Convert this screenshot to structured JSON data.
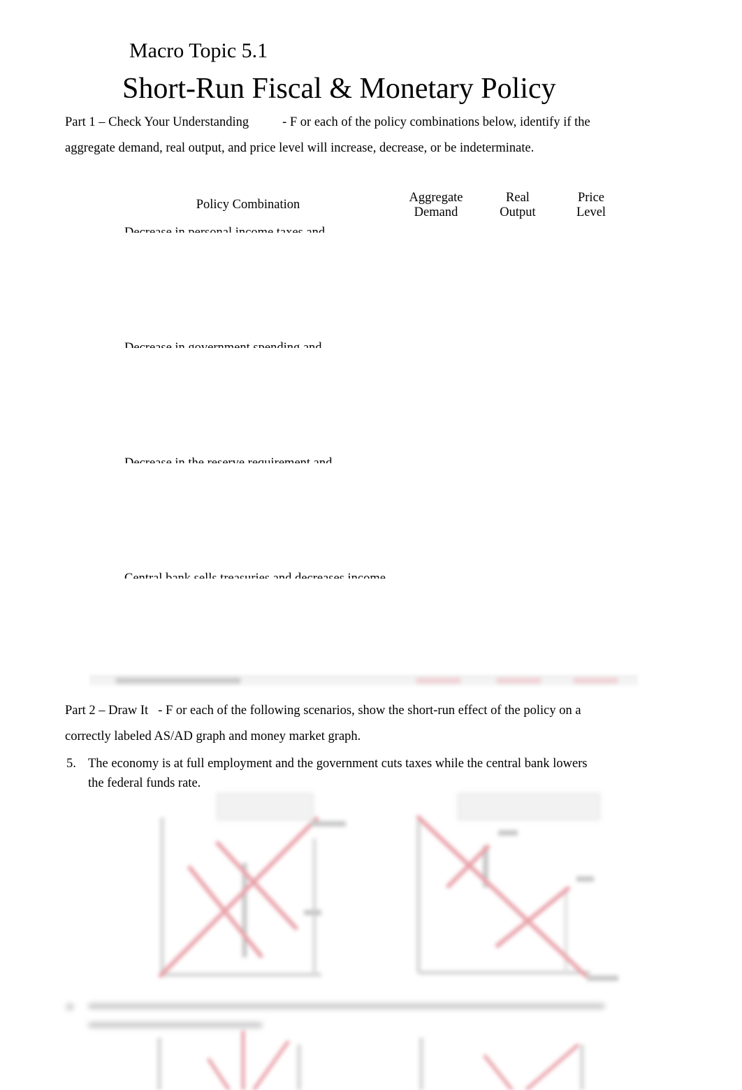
{
  "header": {
    "topic": "Macro Topic 5.1",
    "title": "Short-Run Fiscal & Monetary Policy"
  },
  "part1": {
    "heading": "Part 1 – Check Your Understanding",
    "instruction_line1": "- F or each of the policy combinations below, identify if the",
    "instruction_line2": "aggregate demand, real output, and price level will increase, decrease, or be indeterminate.",
    "table": {
      "headers": {
        "policy": "Policy Combination",
        "ad_line1": "Aggregate",
        "ad_line2": "Demand",
        "ro_line1": "Real",
        "ro_line2": "Output",
        "pl_line1": "Price",
        "pl_line2": "Level"
      },
      "rows": [
        {
          "policy": "Decrease in personal income taxes and"
        },
        {
          "policy": "Decrease in government spending and"
        },
        {
          "policy": "Decrease in the reserve requirement and"
        },
        {
          "policy": "Central bank sells treasuries and decreases income"
        }
      ]
    }
  },
  "part2": {
    "heading": "Part 2 – Draw It",
    "instruction_line1": "- F or each of the following scenarios, show the short-run effect of the policy on a",
    "instruction_line2": "correctly labeled AS/AD graph and money market graph.",
    "questions": [
      {
        "number": "5.",
        "line1": "The economy is at full employment and the government cuts taxes while the central bank lowers",
        "line2": "the federal funds rate."
      }
    ]
  },
  "colors": {
    "curve_red": "#e8a0a8",
    "axis_gray": "#d8d8d8"
  }
}
